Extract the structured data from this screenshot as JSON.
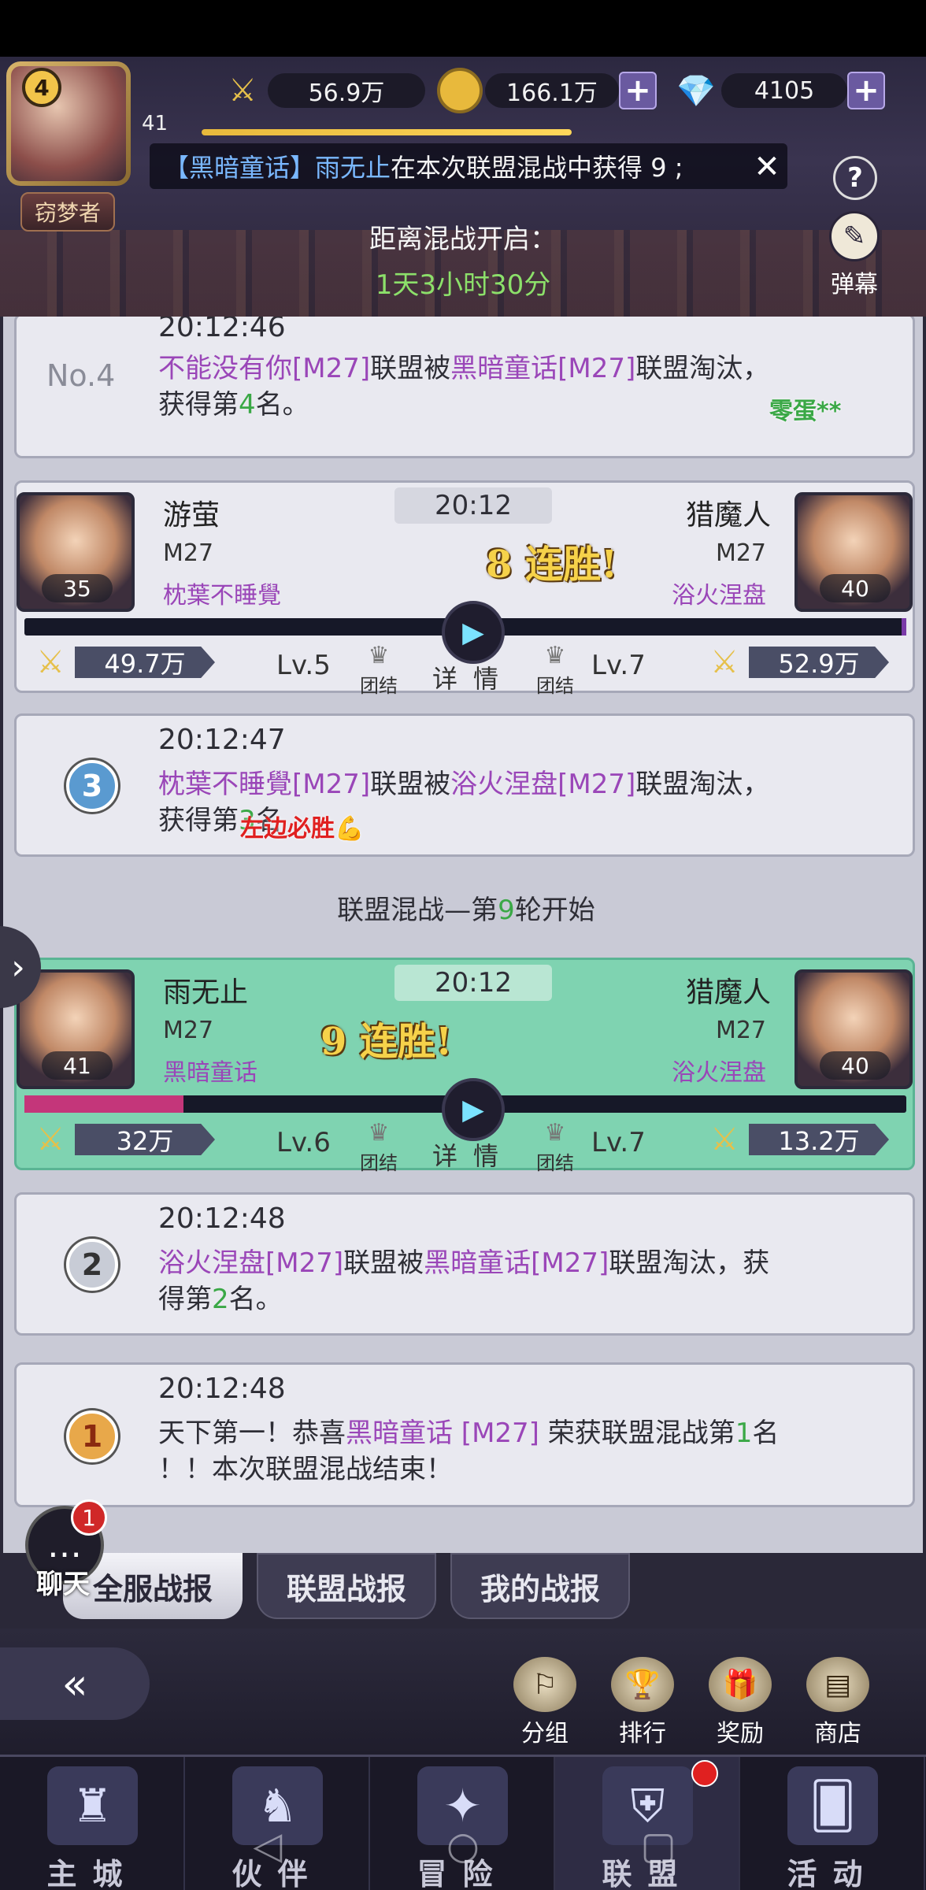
{
  "header": {
    "player_level": "4",
    "avatar_number": "41",
    "title": "窃梦者",
    "power": "56.9万",
    "gold": "166.1万",
    "diamonds": "4105",
    "marquee": {
      "prefix": "【黑暗童话】雨无止",
      "text": "在本次联盟混战中获得 9 ;"
    },
    "countdown_label": "距离混战开启：",
    "countdown_value": "1天3小时30分",
    "danmu_label": "弹幕",
    "help_label": "?"
  },
  "log": {
    "card1": {
      "rank_label": "No.4",
      "time": "20:12:46",
      "loser": "不能没有你[M27]",
      "mid": "联盟被",
      "winner": "黑暗童话[M27]",
      "end": "联盟淘汰，",
      "line2_pre": "获得第",
      "rank": "4",
      "line2_post": "名。",
      "danmaku": "零蛋**"
    },
    "battle1": {
      "left_name": "游萤",
      "left_guild": "M27",
      "left_alliance": "枕葉不睡覺",
      "left_level_badge": "35",
      "time": "20:12",
      "streak": "8 连胜!",
      "right_name": "猎魔人",
      "right_guild": "M27",
      "right_alliance": "浴火涅盘",
      "right_level_badge": "40",
      "left_power": "49.7万",
      "right_power": "52.9万",
      "left_lv": "Lv.5",
      "right_lv": "Lv.7",
      "unity_label": "团结",
      "details_label": "详情",
      "left_hp": 0.0,
      "right_hp": 0.005
    },
    "card2": {
      "medal": "3",
      "time": "20:12:47",
      "loser": "枕葉不睡覺[M27]",
      "mid": "联盟被",
      "winner": "浴火涅盘[M27]",
      "end": "联盟淘汰，",
      "line2_pre": "获得第",
      "rank": "3",
      "line2_post": "名",
      "danmaku": "左边必胜💪"
    },
    "round_label_pre": "联盟混战—第",
    "round_number": "9",
    "round_label_post": "轮开始",
    "battle2": {
      "left_name": "雨无止",
      "left_guild": "M27",
      "left_alliance": "黑暗童话",
      "left_level_badge": "41",
      "time": "20:12",
      "streak": "9 连胜!",
      "right_name": "猎魔人",
      "right_guild": "M27",
      "right_alliance": "浴火涅盘",
      "right_level_badge": "40",
      "left_power": "32万",
      "right_power": "13.2万",
      "left_lv": "Lv.6",
      "right_lv": "Lv.7",
      "unity_label": "团结",
      "details_label": "详情",
      "left_hp": 0.18,
      "right_hp": 0.0
    },
    "card3": {
      "medal": "2",
      "time": "20:12:48",
      "loser": "浴火涅盘[M27]",
      "mid": "联盟被",
      "winner": "黑暗童话[M27]",
      "end": "联盟淘汰，获",
      "line2_pre": "得第",
      "rank": "2",
      "line2_post": "名。"
    },
    "card4": {
      "medal": "1",
      "time": "20:12:48",
      "pre": "天下第一！恭喜",
      "winner": "黑暗童话 [M27]",
      "mid": " 荣获联盟混战第",
      "rank": "1",
      "post": "名",
      "line2": "！！本次联盟混战结束！"
    }
  },
  "chat": {
    "label": "聊天",
    "badge": "1"
  },
  "tabs": [
    "全服战报",
    "联盟战报",
    "我的战报"
  ],
  "functions": [
    "分组",
    "排行",
    "奖励",
    "商店"
  ],
  "nav": [
    "主城",
    "伙伴",
    "冒险",
    "联盟",
    "活动"
  ],
  "colors": {
    "alliance_purple": "#9a46b8",
    "rank_green": "#3aa846",
    "win_card": "#7fd3b1",
    "countdown_green": "#8ce06a"
  }
}
